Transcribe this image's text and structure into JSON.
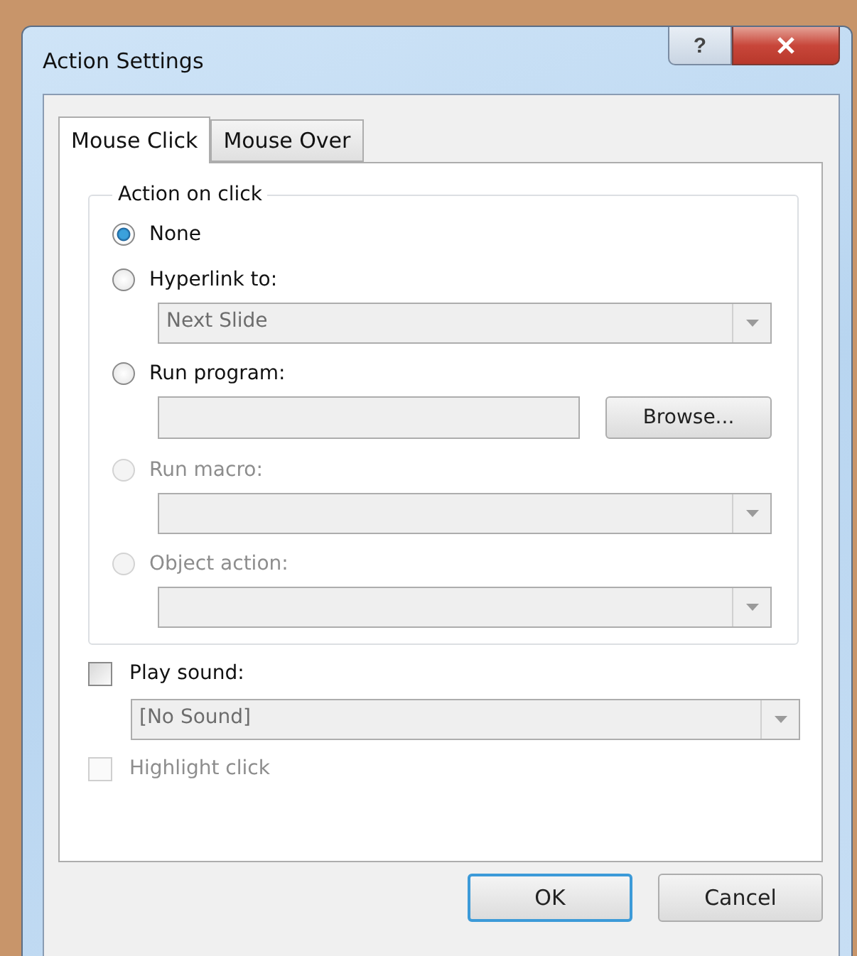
{
  "window": {
    "title": "Action Settings",
    "help_button": "?"
  },
  "tabs": [
    {
      "label": "Mouse Click",
      "selected": true
    },
    {
      "label": "Mouse Over",
      "selected": false
    }
  ],
  "group": {
    "title": "Action on click",
    "options": [
      {
        "label": "None",
        "selected": true,
        "disabled": false
      },
      {
        "label": "Hyperlink to:",
        "selected": false,
        "disabled": false,
        "control": {
          "kind": "dropdown",
          "value": "Next Slide",
          "disabled": true
        }
      },
      {
        "label": "Run program:",
        "selected": false,
        "disabled": false,
        "control": {
          "kind": "file-field",
          "disabled": true,
          "button": {
            "label": "Browse..."
          }
        }
      },
      {
        "label": "Run macro:",
        "selected": false,
        "disabled": true,
        "control": {
          "kind": "dropdown",
          "disabled": true
        }
      },
      {
        "label": "Object action:",
        "selected": false,
        "disabled": true,
        "control": {
          "kind": "dropdown",
          "disabled": true
        }
      }
    ]
  },
  "play_sound": {
    "label": "Play sound:",
    "checked": false,
    "disabled": false,
    "dropdown": {
      "value": "[No Sound]",
      "disabled": true
    }
  },
  "highlight_click": {
    "label": "Highlight click",
    "checked": false,
    "disabled": true
  },
  "buttons": [
    {
      "label": "OK",
      "default": true
    },
    {
      "label": "Cancel",
      "default": false
    }
  ]
}
